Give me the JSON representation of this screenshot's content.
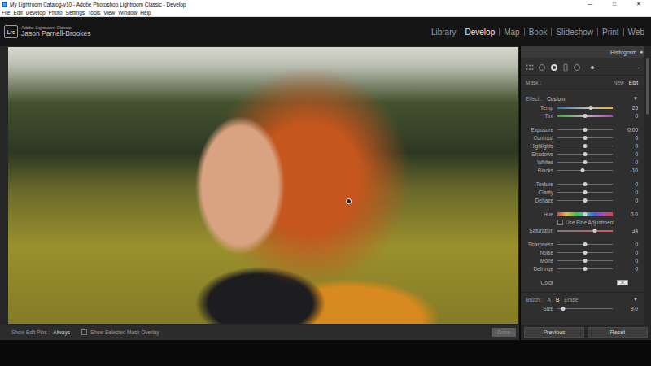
{
  "window": {
    "title": "My Lightroom Catalog-v10 - Adobe Photoshop Lightroom Classic - Develop",
    "controls": [
      "—",
      "□",
      "✕"
    ]
  },
  "menu": [
    "File",
    "Edit",
    "Develop",
    "Photo",
    "Settings",
    "Tools",
    "View",
    "Window",
    "Help"
  ],
  "identity": {
    "logo": "Lrc",
    "product": "Adobe Lightroom Classic",
    "user": "Jason Parnell-Brookes"
  },
  "modules": [
    {
      "label": "Library",
      "selected": false
    },
    {
      "label": "Develop",
      "selected": true
    },
    {
      "label": "Map",
      "selected": false
    },
    {
      "label": "Book",
      "selected": false
    },
    {
      "label": "Slideshow",
      "selected": false
    },
    {
      "label": "Print",
      "selected": false
    },
    {
      "label": "Web",
      "selected": false
    }
  ],
  "toolbar": {
    "pins_label": "Show Edit Pins :",
    "pins_value": "Always",
    "overlay": {
      "label": "Show Selected Mask Overlay",
      "checked": false
    },
    "done": {
      "label": "Done",
      "disabled": true
    }
  },
  "panel": {
    "title": "Histogram",
    "collapse": "◂",
    "tools_slider": {
      "level": 0.02
    },
    "mask": {
      "label": "Mask :",
      "actions": [
        {
          "label": "New",
          "selected": false
        },
        {
          "label": "Edit",
          "selected": true
        }
      ]
    },
    "effect": {
      "label": "Effect :",
      "value": "Custom",
      "toggle": "▼"
    },
    "groups": [
      [
        {
          "kind": "temp",
          "label": "Temp",
          "value": "25",
          "level": 0.6
        },
        {
          "kind": "tint",
          "label": "Tint",
          "value": "0",
          "level": 0.5
        }
      ],
      [
        {
          "kind": "plain",
          "label": "Exposure",
          "value": "0.00",
          "level": 0.5
        },
        {
          "kind": "plain",
          "label": "Contrast",
          "value": "0",
          "level": 0.5
        },
        {
          "kind": "plain",
          "label": "Highlights",
          "value": "0",
          "level": 0.5
        },
        {
          "kind": "plain",
          "label": "Shadows",
          "value": "0",
          "level": 0.5
        },
        {
          "kind": "plain",
          "label": "Whites",
          "value": "0",
          "level": 0.5
        },
        {
          "kind": "plain",
          "label": "Blacks",
          "value": "-10",
          "level": 0.45
        }
      ],
      [
        {
          "kind": "plain",
          "label": "Texture",
          "value": "0",
          "level": 0.5
        },
        {
          "kind": "plain",
          "label": "Clarity",
          "value": "0",
          "level": 0.5
        },
        {
          "kind": "plain",
          "label": "Dehaze",
          "value": "0",
          "level": 0.5
        }
      ],
      [
        {
          "kind": "hue",
          "label": "Hue",
          "value": "0.0",
          "level": 0.5
        },
        {
          "kind": "checkbox",
          "label": "Use Fine Adjustment",
          "checked": false
        },
        {
          "kind": "saturation",
          "label": "Saturation",
          "value": "34",
          "level": 0.67
        }
      ],
      [
        {
          "kind": "plain",
          "label": "Sharpness",
          "value": "0",
          "level": 0.5
        },
        {
          "kind": "plain",
          "label": "Noise",
          "value": "0",
          "level": 0.5
        },
        {
          "kind": "plain",
          "label": "Moire",
          "value": "0",
          "level": 0.5
        },
        {
          "kind": "plain",
          "label": "Defringe",
          "value": "0",
          "level": 0.5
        }
      ],
      [
        {
          "kind": "swatch",
          "label": "Color"
        }
      ]
    ],
    "brush": {
      "label": "Brush :",
      "options": [
        {
          "label": "A",
          "selected": false
        },
        {
          "label": "B",
          "selected": true
        },
        {
          "label": "Erase",
          "selected": false
        }
      ],
      "toggle": "▼"
    },
    "size": {
      "kind": "plain",
      "label": "Size",
      "value": "9.0",
      "level": 0.1
    }
  },
  "buttons": [
    "Previous",
    "Reset"
  ]
}
